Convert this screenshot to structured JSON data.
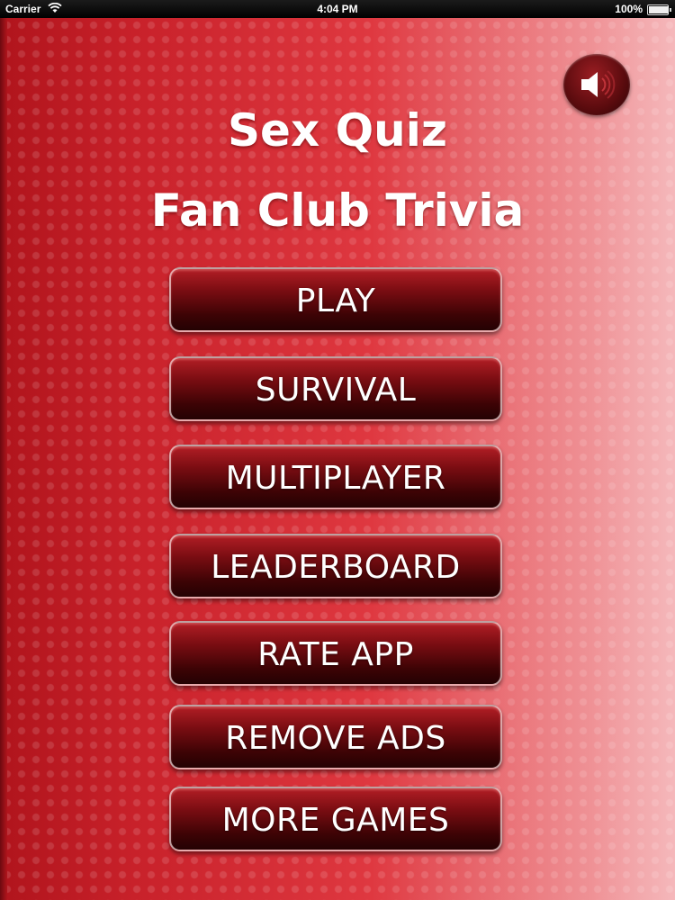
{
  "status_bar": {
    "carrier": "Carrier",
    "time": "4:04 PM",
    "battery": "100%"
  },
  "title": {
    "line1": "Sex Quiz",
    "line2": "Fan Club Trivia"
  },
  "sound_button": {
    "icon": "speaker-icon"
  },
  "menu": [
    {
      "label": "PLAY"
    },
    {
      "label": "SURVIVAL"
    },
    {
      "label": "MULTIPLAYER"
    },
    {
      "label": "LEADERBOARD"
    },
    {
      "label": "RATE APP"
    },
    {
      "label": "REMOVE ADS"
    },
    {
      "label": "MORE GAMES"
    }
  ],
  "colors": {
    "background_red": "#c8212a",
    "button_dark_red": "#3d0305",
    "text": "#ffffff"
  }
}
